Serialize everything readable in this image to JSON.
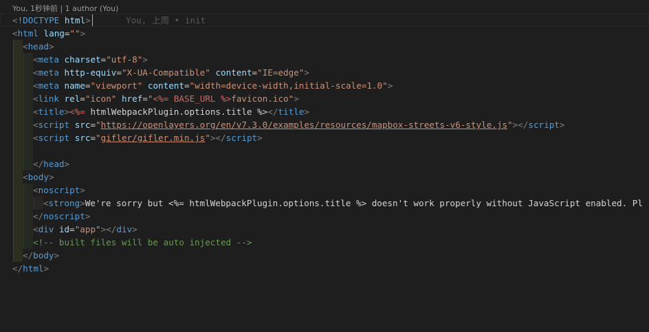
{
  "codelens": "You, 1秒钟前 | 1 author (You)",
  "blame": "You, 上周 • init",
  "lines": [
    {
      "indent": 0,
      "segments": [
        {
          "t": "pu",
          "v": "<"
        },
        {
          "t": "t",
          "v": "!DOCTYPE"
        },
        {
          "t": "d",
          "v": " "
        },
        {
          "t": "a",
          "v": "html"
        },
        {
          "t": "pu",
          "v": ">"
        }
      ]
    },
    {
      "indent": 0,
      "segments": [
        {
          "t": "pu",
          "v": "<"
        },
        {
          "t": "t",
          "v": "html"
        },
        {
          "t": "d",
          "v": " "
        },
        {
          "t": "a",
          "v": "lang"
        },
        {
          "t": "d",
          "v": "="
        },
        {
          "t": "s",
          "v": "\"\""
        },
        {
          "t": "pu",
          "v": ">"
        }
      ]
    },
    {
      "indent": 1,
      "segments": [
        {
          "t": "pu",
          "v": "<"
        },
        {
          "t": "t",
          "v": "head"
        },
        {
          "t": "pu",
          "v": ">"
        }
      ]
    },
    {
      "indent": 2,
      "segments": [
        {
          "t": "pu",
          "v": "<"
        },
        {
          "t": "t",
          "v": "meta"
        },
        {
          "t": "d",
          "v": " "
        },
        {
          "t": "a",
          "v": "charset"
        },
        {
          "t": "d",
          "v": "="
        },
        {
          "t": "s",
          "v": "\"utf-8\""
        },
        {
          "t": "pu",
          "v": ">"
        }
      ]
    },
    {
      "indent": 2,
      "segments": [
        {
          "t": "pu",
          "v": "<"
        },
        {
          "t": "t",
          "v": "meta"
        },
        {
          "t": "d",
          "v": " "
        },
        {
          "t": "a",
          "v": "http-equiv"
        },
        {
          "t": "d",
          "v": "="
        },
        {
          "t": "s",
          "v": "\"X-UA-Compatible\""
        },
        {
          "t": "d",
          "v": " "
        },
        {
          "t": "a",
          "v": "content"
        },
        {
          "t": "d",
          "v": "="
        },
        {
          "t": "s",
          "v": "\"IE=edge\""
        },
        {
          "t": "pu",
          "v": ">"
        }
      ]
    },
    {
      "indent": 2,
      "segments": [
        {
          "t": "pu",
          "v": "<"
        },
        {
          "t": "t",
          "v": "meta"
        },
        {
          "t": "d",
          "v": " "
        },
        {
          "t": "a",
          "v": "name"
        },
        {
          "t": "d",
          "v": "="
        },
        {
          "t": "s",
          "v": "\"viewport\""
        },
        {
          "t": "d",
          "v": " "
        },
        {
          "t": "a",
          "v": "content"
        },
        {
          "t": "d",
          "v": "="
        },
        {
          "t": "s",
          "v": "\"width=device-width,initial-scale=1.0\""
        },
        {
          "t": "pu",
          "v": ">"
        }
      ]
    },
    {
      "indent": 2,
      "segments": [
        {
          "t": "pu",
          "v": "<"
        },
        {
          "t": "t",
          "v": "link"
        },
        {
          "t": "d",
          "v": " "
        },
        {
          "t": "a",
          "v": "rel"
        },
        {
          "t": "d",
          "v": "="
        },
        {
          "t": "s",
          "v": "\"icon\""
        },
        {
          "t": "d",
          "v": " "
        },
        {
          "t": "a",
          "v": "href"
        },
        {
          "t": "d",
          "v": "="
        },
        {
          "t": "s",
          "v": "\""
        },
        {
          "t": "tpl",
          "v": "<%= BASE_URL %>"
        },
        {
          "t": "s",
          "v": "favicon.ico\""
        },
        {
          "t": "pu",
          "v": ">"
        }
      ]
    },
    {
      "indent": 2,
      "segments": [
        {
          "t": "pu",
          "v": "<"
        },
        {
          "t": "t",
          "v": "title"
        },
        {
          "t": "pu",
          "v": ">"
        },
        {
          "t": "tpl",
          "v": "<%="
        },
        {
          "t": "d",
          "v": " htmlWebpackPlugin.options.title "
        },
        {
          "t": "d",
          "v": "%>"
        },
        {
          "t": "pu",
          "v": "</"
        },
        {
          "t": "t",
          "v": "title"
        },
        {
          "t": "pu",
          "v": ">"
        }
      ]
    },
    {
      "indent": 2,
      "segments": [
        {
          "t": "pu",
          "v": "<"
        },
        {
          "t": "t",
          "v": "script"
        },
        {
          "t": "d",
          "v": " "
        },
        {
          "t": "a",
          "v": "src"
        },
        {
          "t": "d",
          "v": "="
        },
        {
          "t": "s",
          "v": "\""
        },
        {
          "t": "su",
          "v": "https://openlayers.org/en/v7.3.0/examples/resources/mapbox-streets-v6-style.js"
        },
        {
          "t": "s",
          "v": "\""
        },
        {
          "t": "pu",
          "v": "></"
        },
        {
          "t": "t",
          "v": "script"
        },
        {
          "t": "pu",
          "v": ">"
        }
      ]
    },
    {
      "indent": 2,
      "segments": [
        {
          "t": "pu",
          "v": "<"
        },
        {
          "t": "t",
          "v": "script"
        },
        {
          "t": "d",
          "v": " "
        },
        {
          "t": "a",
          "v": "src"
        },
        {
          "t": "d",
          "v": "="
        },
        {
          "t": "s",
          "v": "\""
        },
        {
          "t": "su",
          "v": "gifler/gifler.min.js"
        },
        {
          "t": "s",
          "v": "\""
        },
        {
          "t": "pu",
          "v": "></"
        },
        {
          "t": "t",
          "v": "script"
        },
        {
          "t": "pu",
          "v": ">"
        }
      ]
    },
    {
      "indent": 2,
      "segments": []
    },
    {
      "indent": 2,
      "segments": [
        {
          "t": "pu",
          "v": "</"
        },
        {
          "t": "t",
          "v": "head"
        },
        {
          "t": "pu",
          "v": ">"
        }
      ]
    },
    {
      "indent": 1,
      "segments": [
        {
          "t": "pu",
          "v": "<"
        },
        {
          "t": "t",
          "v": "body"
        },
        {
          "t": "pu",
          "v": ">"
        }
      ]
    },
    {
      "indent": 2,
      "segments": [
        {
          "t": "pu",
          "v": "<"
        },
        {
          "t": "t",
          "v": "noscript"
        },
        {
          "t": "pu",
          "v": ">"
        }
      ]
    },
    {
      "indent": 3,
      "segments": [
        {
          "t": "pu",
          "v": "<"
        },
        {
          "t": "t",
          "v": "strong"
        },
        {
          "t": "pu",
          "v": ">"
        },
        {
          "t": "d",
          "v": "We're sorry but <%= htmlWebpackPlugin.options.title %> doesn't work properly without JavaScript enabled. Pl"
        }
      ]
    },
    {
      "indent": 2,
      "segments": [
        {
          "t": "pu",
          "v": "</"
        },
        {
          "t": "t",
          "v": "noscript"
        },
        {
          "t": "pu",
          "v": ">"
        }
      ]
    },
    {
      "indent": 2,
      "segments": [
        {
          "t": "pu",
          "v": "<"
        },
        {
          "t": "t",
          "v": "div"
        },
        {
          "t": "d",
          "v": " "
        },
        {
          "t": "a",
          "v": "id"
        },
        {
          "t": "d",
          "v": "="
        },
        {
          "t": "s",
          "v": "\"app\""
        },
        {
          "t": "pu",
          "v": "></"
        },
        {
          "t": "t",
          "v": "div"
        },
        {
          "t": "pu",
          "v": ">"
        }
      ]
    },
    {
      "indent": 2,
      "segments": [
        {
          "t": "c",
          "v": "<!-- built files will be auto injected -->"
        }
      ]
    },
    {
      "indent": 1,
      "segments": [
        {
          "t": "pu",
          "v": "</"
        },
        {
          "t": "t",
          "v": "body"
        },
        {
          "t": "pu",
          "v": ">"
        }
      ]
    },
    {
      "indent": 0,
      "segments": [
        {
          "t": "pu",
          "v": "</"
        },
        {
          "t": "t",
          "v": "html"
        },
        {
          "t": "pu",
          "v": ">"
        }
      ]
    }
  ]
}
